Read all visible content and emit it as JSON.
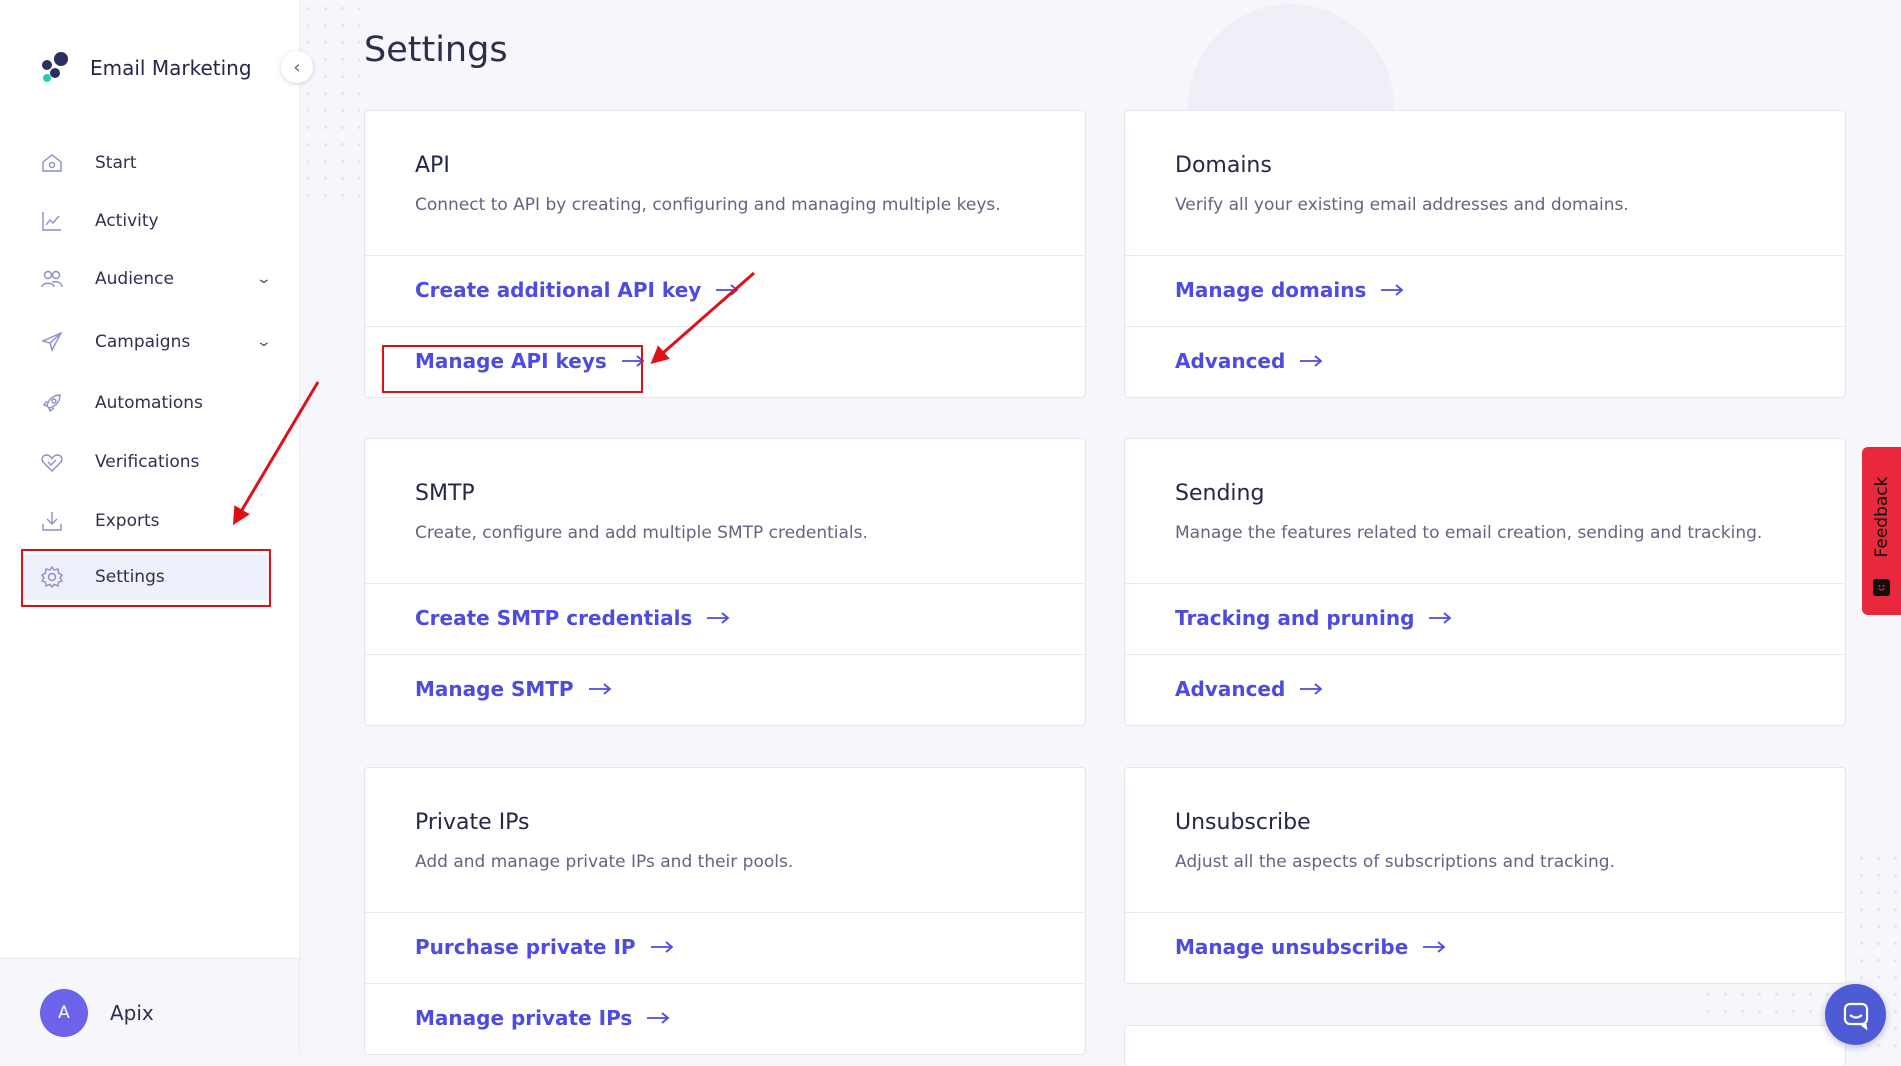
{
  "app": {
    "name": "Email Marketing",
    "logo_icon": "brand-logo-icon"
  },
  "sidebar": {
    "collapse_icon": "chevron-left-icon",
    "items": [
      {
        "label": "Start",
        "icon": "home-icon"
      },
      {
        "label": "Activity",
        "icon": "chart-line-icon"
      },
      {
        "label": "Audience",
        "icon": "users-icon",
        "expandable": true
      },
      {
        "label": "Campaigns",
        "icon": "paper-plane-icon",
        "expandable": true
      },
      {
        "label": "Automations",
        "icon": "rocket-icon"
      },
      {
        "label": "Verifications",
        "icon": "heart-check-icon"
      },
      {
        "label": "Exports",
        "icon": "download-icon"
      },
      {
        "label": "Settings",
        "icon": "gear-icon",
        "active": true
      }
    ],
    "user": {
      "initial": "A",
      "name": "Apix"
    }
  },
  "main": {
    "title": "Settings",
    "cards": [
      {
        "title": "API",
        "description": "Connect to API by creating, configuring and managing multiple keys.",
        "links": [
          "Create additional API key",
          "Manage API keys"
        ]
      },
      {
        "title": "Domains",
        "description": "Verify all your existing email addresses and domains.",
        "links": [
          "Manage domains",
          "Advanced"
        ]
      },
      {
        "title": "SMTP",
        "description": "Create, configure and add multiple SMTP credentials.",
        "links": [
          "Create SMTP credentials",
          "Manage SMTP"
        ]
      },
      {
        "title": "Sending",
        "description": "Manage the features related to email creation, sending and tracking.",
        "links": [
          "Tracking and pruning",
          "Advanced"
        ]
      },
      {
        "title": "Private IPs",
        "description": "Add and manage private IPs and their pools.",
        "links": [
          "Purchase private IP",
          "Manage private IPs"
        ]
      },
      {
        "title": "Unsubscribe",
        "description": "Adjust all the aspects of subscriptions and tracking.",
        "links": [
          "Manage unsubscribe"
        ]
      }
    ]
  },
  "feedback": {
    "label": "Feedback"
  },
  "chat": {
    "icon": "chat-icon"
  },
  "colors": {
    "accent": "#4e4ce0",
    "annotation": "#e0101a",
    "feedback": "#e8283c",
    "avatar": "#6d63ea"
  }
}
